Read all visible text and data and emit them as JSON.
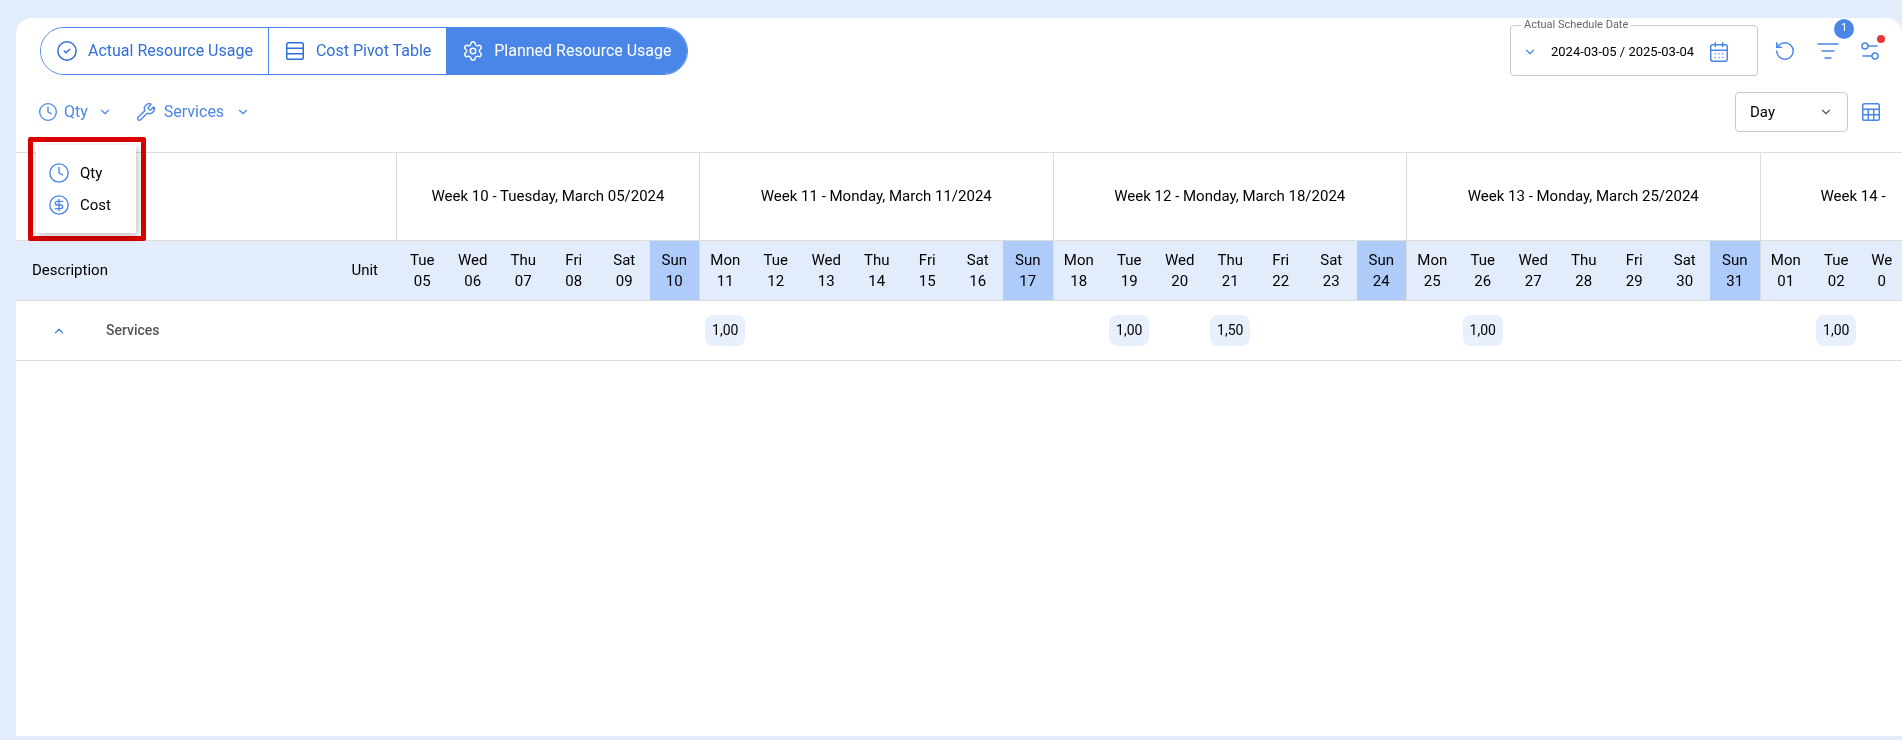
{
  "tabs": [
    {
      "label": "Actual Resource Usage",
      "selected": false
    },
    {
      "label": "Cost Pivot Table",
      "selected": false
    },
    {
      "label": "Planned Resource Usage",
      "selected": true
    }
  ],
  "date_range": {
    "label": "Actual Schedule Date",
    "value": "2024-03-05 / 2025-03-04"
  },
  "filter_badge": "1",
  "settings_alert": true,
  "metric_dropdown": {
    "label": "Qty",
    "expanded": true,
    "options": [
      {
        "label": "Qty"
      },
      {
        "label": "Cost"
      }
    ]
  },
  "group_dropdown": {
    "label": "Services"
  },
  "view_select": {
    "value": "Day"
  },
  "table": {
    "columns": [
      "Description",
      "Unit"
    ],
    "weeks": [
      {
        "label": "Week 10 - Tuesday, March 05/2024",
        "days": [
          {
            "day": "Tue",
            "date": "05",
            "weekend": false
          },
          {
            "day": "Wed",
            "date": "06",
            "weekend": false
          },
          {
            "day": "Thu",
            "date": "07",
            "weekend": false
          },
          {
            "day": "Fri",
            "date": "08",
            "weekend": false
          },
          {
            "day": "Sat",
            "date": "09",
            "weekend": false
          },
          {
            "day": "Sun",
            "date": "10",
            "weekend": true
          }
        ]
      },
      {
        "label": "Week 11 - Monday, March 11/2024",
        "days": [
          {
            "day": "Mon",
            "date": "11",
            "weekend": false
          },
          {
            "day": "Tue",
            "date": "12",
            "weekend": false
          },
          {
            "day": "Wed",
            "date": "13",
            "weekend": false
          },
          {
            "day": "Thu",
            "date": "14",
            "weekend": false
          },
          {
            "day": "Fri",
            "date": "15",
            "weekend": false
          },
          {
            "day": "Sat",
            "date": "16",
            "weekend": false
          },
          {
            "day": "Sun",
            "date": "17",
            "weekend": true
          }
        ]
      },
      {
        "label": "Week 12 - Monday, March 18/2024",
        "days": [
          {
            "day": "Mon",
            "date": "18",
            "weekend": false
          },
          {
            "day": "Tue",
            "date": "19",
            "weekend": false
          },
          {
            "day": "Wed",
            "date": "20",
            "weekend": false
          },
          {
            "day": "Thu",
            "date": "21",
            "weekend": false
          },
          {
            "day": "Fri",
            "date": "22",
            "weekend": false
          },
          {
            "day": "Sat",
            "date": "23",
            "weekend": false
          },
          {
            "day": "Sun",
            "date": "24",
            "weekend": true
          }
        ]
      },
      {
        "label": "Week 13 - Monday, March 25/2024",
        "days": [
          {
            "day": "Mon",
            "date": "25",
            "weekend": false
          },
          {
            "day": "Tue",
            "date": "26",
            "weekend": false
          },
          {
            "day": "Wed",
            "date": "27",
            "weekend": false
          },
          {
            "day": "Thu",
            "date": "28",
            "weekend": false
          },
          {
            "day": "Fri",
            "date": "29",
            "weekend": false
          },
          {
            "day": "Sat",
            "date": "30",
            "weekend": false
          },
          {
            "day": "Sun",
            "date": "31",
            "weekend": true
          }
        ]
      },
      {
        "label": "Week 14 -",
        "days": [
          {
            "day": "Mon",
            "date": "01",
            "weekend": false
          },
          {
            "day": "Tue",
            "date": "02",
            "weekend": false
          },
          {
            "day": "We",
            "date": "0",
            "weekend": false
          }
        ]
      }
    ],
    "rows": [
      {
        "description": "Services",
        "expanded": true,
        "cells": [
          null,
          null,
          null,
          null,
          null,
          null,
          "1,00",
          null,
          null,
          null,
          null,
          null,
          null,
          null,
          "1,00",
          null,
          "1,50",
          null,
          null,
          null,
          null,
          "1,00",
          null,
          null,
          null,
          null,
          null,
          null,
          "1,00",
          null
        ]
      }
    ]
  }
}
